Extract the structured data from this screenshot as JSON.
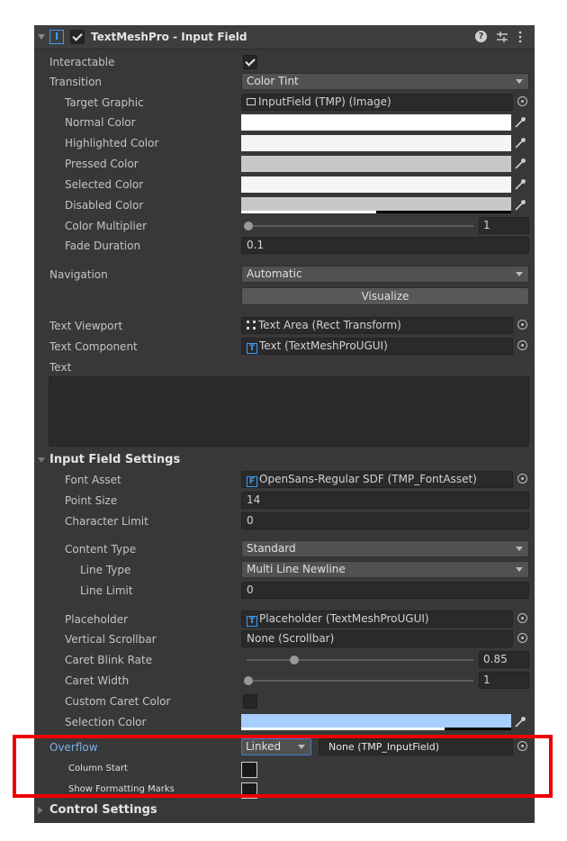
{
  "component": {
    "title": "TextMeshPro - Input Field"
  },
  "fields": {
    "interactable": "Interactable",
    "transition": {
      "label": "Transition",
      "value": "Color Tint"
    },
    "target_graphic": {
      "label": "Target Graphic",
      "value": "InputField (TMP) (Image)"
    },
    "normal_color": {
      "label": "Normal Color",
      "color": "#ffffff"
    },
    "highlighted_color": {
      "label": "Highlighted Color",
      "color": "#f5f5f5"
    },
    "pressed_color": {
      "label": "Pressed Color",
      "color": "#c8c8c8"
    },
    "selected_color": {
      "label": "Selected Color",
      "color": "#f5f5f5"
    },
    "disabled_color": {
      "label": "Disabled Color",
      "color": "#c8c8c8"
    },
    "color_multiplier": {
      "label": "Color Multiplier",
      "value": "1"
    },
    "fade_duration": {
      "label": "Fade Duration",
      "value": "0.1"
    },
    "navigation": {
      "label": "Navigation",
      "value": "Automatic"
    },
    "visualize": "Visualize",
    "text_viewport": {
      "label": "Text Viewport",
      "value": "Text Area (Rect Transform)"
    },
    "text_component": {
      "label": "Text Component",
      "value": "Text (TextMeshProUGUI)"
    },
    "text": {
      "label": "Text",
      "value": ""
    }
  },
  "input_field_settings": {
    "header": "Input Field Settings",
    "font_asset": {
      "label": "Font Asset",
      "value": "OpenSans-Regular SDF (TMP_FontAsset)"
    },
    "point_size": {
      "label": "Point Size",
      "value": "14"
    },
    "character_limit": {
      "label": "Character Limit",
      "value": "0"
    },
    "content_type": {
      "label": "Content Type",
      "value": "Standard"
    },
    "line_type": {
      "label": "Line Type",
      "value": "Multi Line Newline"
    },
    "line_limit": {
      "label": "Line Limit",
      "value": "0"
    },
    "placeholder": {
      "label": "Placeholder",
      "value": "Placeholder (TextMeshProUGUI)"
    },
    "vertical_scrollbar": {
      "label": "Vertical Scrollbar",
      "value": "None (Scrollbar)"
    },
    "caret_blink_rate": {
      "label": "Caret Blink Rate",
      "value": "0.85"
    },
    "caret_width": {
      "label": "Caret Width",
      "value": "1"
    },
    "custom_caret_color": {
      "label": "Custom Caret Color"
    },
    "selection_color": {
      "label": "Selection Color",
      "color": "#a8ceff"
    },
    "overflow": {
      "label": "Overflow",
      "mode": "Linked",
      "target": "None (TMP_InputField)"
    },
    "column_start": {
      "label": "Column Start"
    },
    "show_formatting_marks": {
      "label": "Show Formatting Marks"
    }
  },
  "control_settings": {
    "header": "Control Settings"
  },
  "colors": {
    "highlight_box": "#ee0000",
    "accent": "#3b9cf4",
    "panel_bg": "#383838"
  }
}
